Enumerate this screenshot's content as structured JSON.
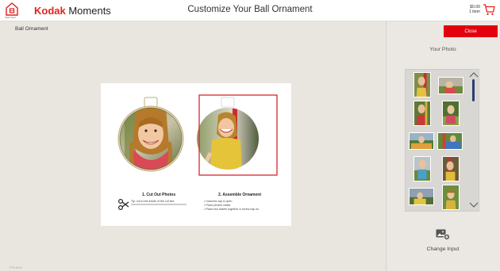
{
  "header": {
    "home_label": "Start Over",
    "brand_bold": "Kodak",
    "brand_rest": " Moments",
    "title": "Customize Your Ball Ornament",
    "cart_price": "$0.00",
    "cart_items": "1 item"
  },
  "workspace": {
    "breadcrumb": "Ball Ornament",
    "footer": "PRV-0644"
  },
  "instructions": {
    "step1_title": "1. Cut Out Photos",
    "step1_tip": "Tip: cut to the inside of the cut line.",
    "step2_title": "2. Assemble Ornament",
    "step2_lines": [
      "• Unscrew cap & open.",
      "• Place photos inside.",
      "• Place two halves together & screw cap on."
    ]
  },
  "panel": {
    "close_label": "Close",
    "your_photo_label": "Your Photo",
    "change_input_label": "Change Input"
  },
  "colors": {
    "brand_red": "#e2231a",
    "close_red": "#e2000f",
    "selection_red": "#d8262c",
    "scrollbar": "#2b3d6e"
  },
  "icons": {
    "home": "home-icon",
    "cart": "cart-icon",
    "scissors": "scissors-icon",
    "change_input": "add-image-icon",
    "scroll_up": "chevron-up-icon",
    "scroll_down": "chevron-down-icon"
  }
}
